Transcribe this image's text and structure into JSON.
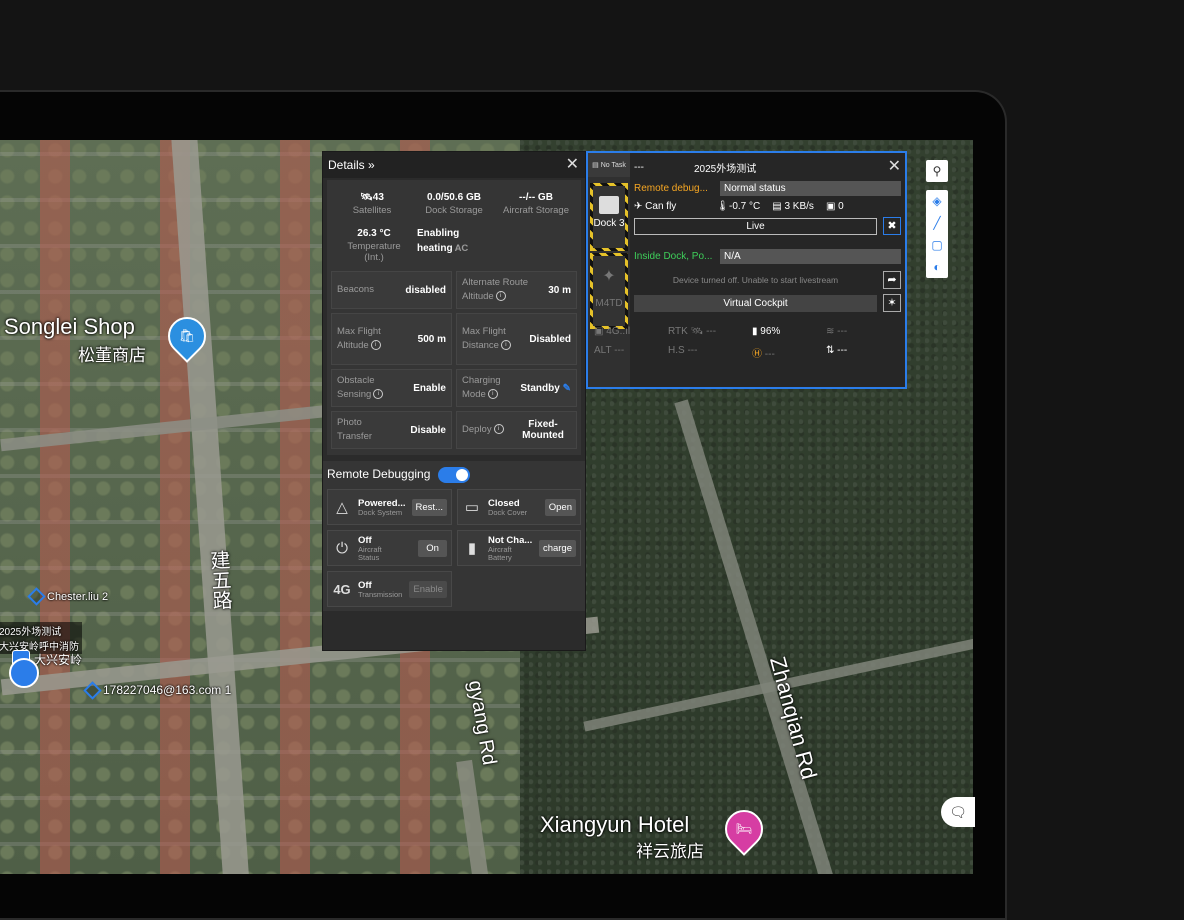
{
  "map": {
    "shop_name_en": "Songlei Shop",
    "shop_name_zh": "松董商店",
    "hotel_name_en": "Xiangyun Hotel",
    "hotel_name_zh": "祥云旅店",
    "road_jianwu": "建五路",
    "road_zhangqian": "Zhanqian Rd",
    "road_gyang": "gyang Rd",
    "poi_chester": "Chester.liu 2",
    "poi_site_line1": "2025外场测试",
    "poi_site_line2": "大兴安岭呼中消防",
    "poi_daxinganling": "大兴安岭",
    "poi_email": "178227046@163.com 1"
  },
  "details": {
    "title": "Details",
    "stats_row1": [
      {
        "value": "43",
        "label": "Satellites"
      },
      {
        "value": "0.0/50.6 GB",
        "label": "Dock Storage"
      },
      {
        "value": "--/-- GB",
        "label": "Aircraft Storage"
      }
    ],
    "temperature": {
      "value": "26.3 °C",
      "label": "Temperature (Int.)"
    },
    "ac": {
      "value_line1": "Enabling",
      "value_line2": "heating",
      "label": "AC"
    },
    "settings": [
      {
        "label": "Beacons",
        "value": "disabled"
      },
      {
        "label": "Alternate Route Altitude",
        "value": "30 m"
      },
      {
        "label": "Max Flight Altitude",
        "value": "500 m"
      },
      {
        "label": "Max Flight Distance",
        "value": "Disabled"
      },
      {
        "label": "Obstacle Sensing",
        "value": "Enable"
      },
      {
        "label": "Charging Mode",
        "value": "Standby"
      },
      {
        "label": "Photo Transfer",
        "value": "Disable"
      },
      {
        "label": "Deploy",
        "value": "Fixed-Mounted"
      }
    ],
    "remote_debugging": {
      "label": "Remote Debugging",
      "items": [
        {
          "status": "Powered...",
          "sub": "Dock System",
          "button": "Rest..."
        },
        {
          "status": "Closed",
          "sub": "Dock Cover",
          "button": "Open"
        },
        {
          "status": "Off",
          "sub": "Aircraft Status",
          "button": "On"
        },
        {
          "status": "Not Cha...",
          "sub": "Aircraft Battery",
          "button": "charge"
        },
        {
          "status": "Off",
          "sub": "Transmission",
          "button": "Enable",
          "icon_text": "4G"
        }
      ]
    }
  },
  "dock_panel": {
    "no_task": "No Task",
    "dash": "---",
    "site_name": "2025外场测试",
    "dock_label": "Dock 3",
    "aircraft_label": "M4TD",
    "remote_debug": "Remote debug...",
    "status": "Normal status",
    "can_fly": "Can fly",
    "temp": "-0.7 °C",
    "rate": "3 KB/s",
    "count": "0",
    "live": "Live",
    "inside_dock": "Inside Dock, Po...",
    "na": "N/A",
    "device_msg": "Device turned off. Unable to start livestream",
    "virtual_cockpit": "Virtual Cockpit",
    "signal": "4G..ıl",
    "rtk": "RTK",
    "rtk_val": "---",
    "battery": "96%",
    "speed_val": "---",
    "alt": "ALT",
    "alt_val": "---",
    "hs": "H.S",
    "hs_val": "---",
    "h_val": "---",
    "vs_val": "---"
  },
  "colors": {
    "accent": "#2b7de9",
    "warning": "#f5a623",
    "ok": "#3ecf5a",
    "hazard": "#e6c229"
  }
}
